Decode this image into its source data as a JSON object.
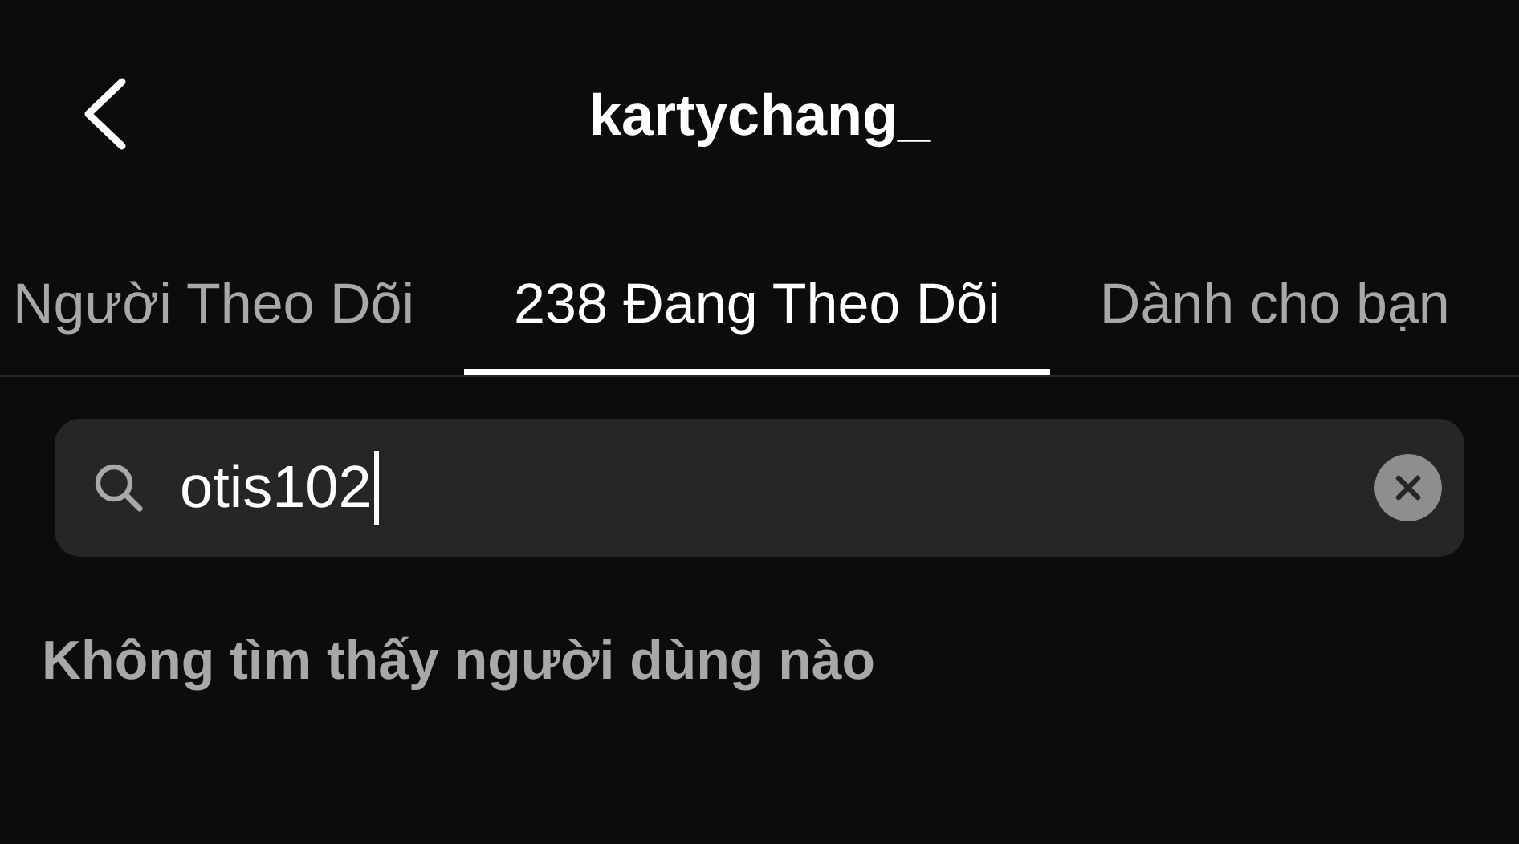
{
  "header": {
    "title": "kartychang_"
  },
  "tabs": [
    {
      "label": "Người Theo Dõi",
      "selected": false
    },
    {
      "label": "238 Đang Theo Dõi",
      "selected": true
    },
    {
      "label": "Dành cho bạn",
      "selected": false
    }
  ],
  "search": {
    "value": "otis102",
    "focused": true
  },
  "empty_message": "Không tìm thấy người dùng nào"
}
